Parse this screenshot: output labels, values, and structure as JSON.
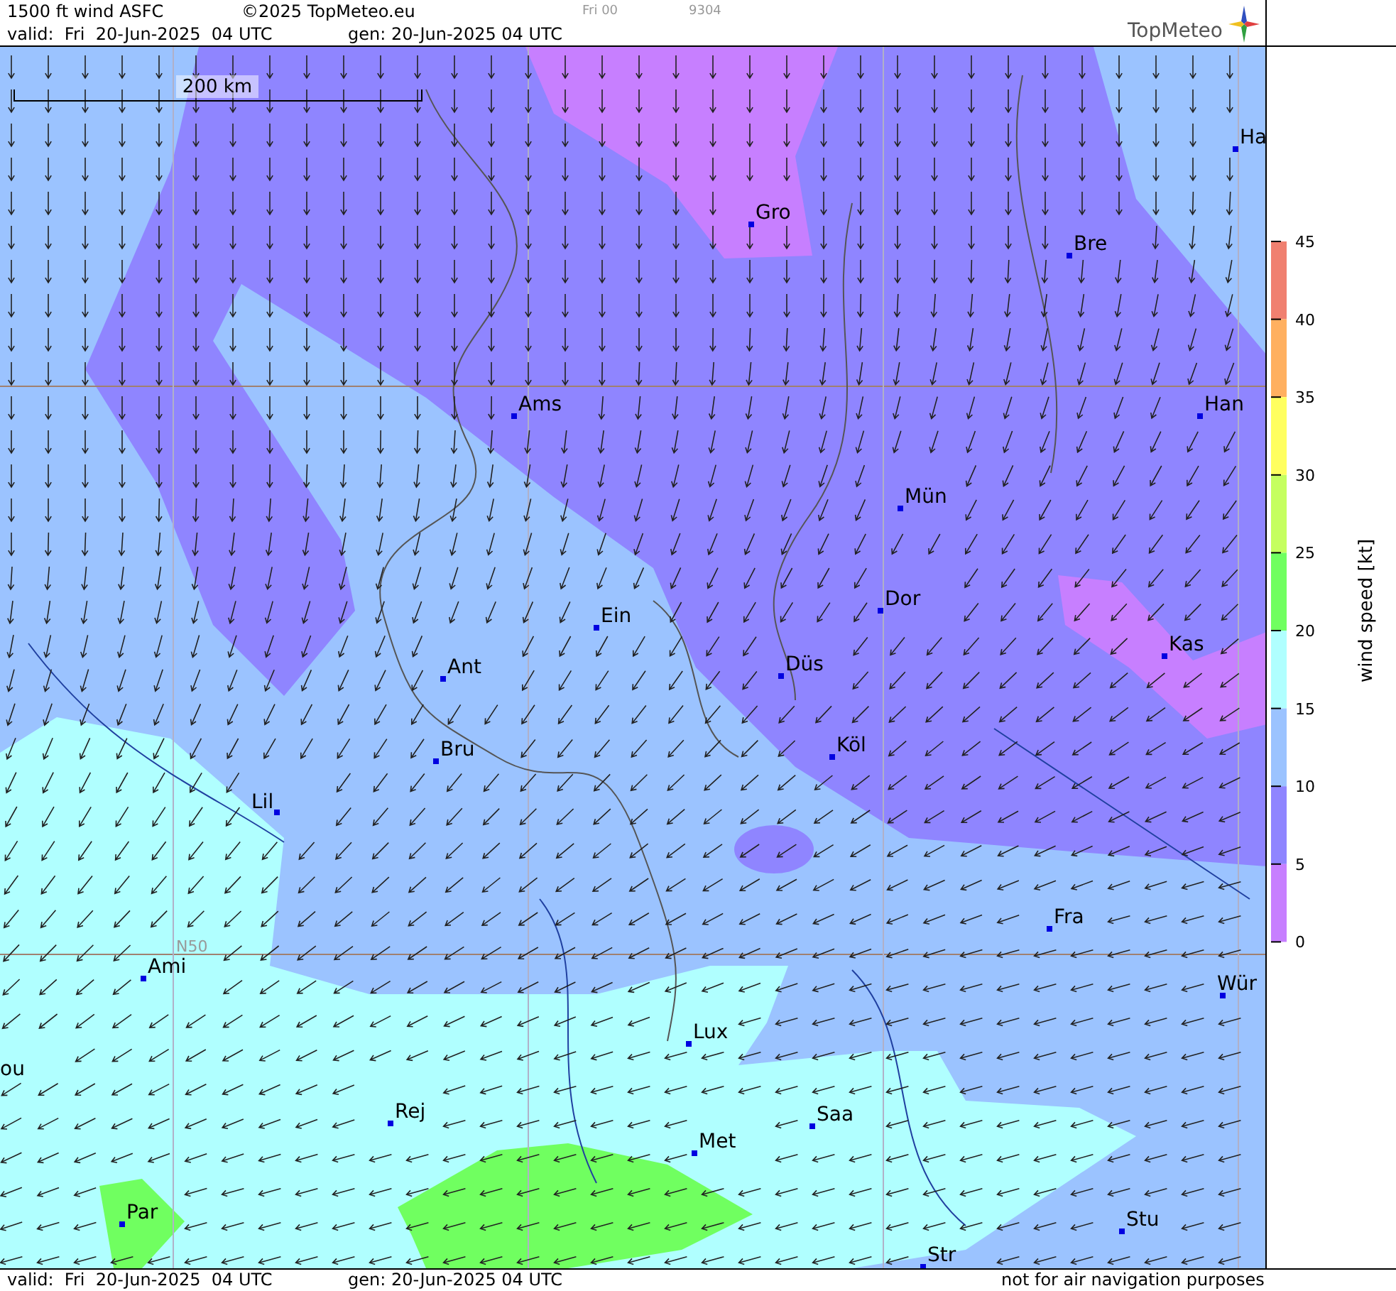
{
  "header": {
    "title": "1500 ft wind ASFC",
    "copyright": "©2025 TopMeteo.eu",
    "run": "Fri 00",
    "code": "9304",
    "valid": "valid:  Fri  20-Jun-2025  04 UTC",
    "generated": "gen: 20-Jun-2025 04 UTC",
    "logo": "TopMeteo"
  },
  "map": {
    "scale_label": "200 km",
    "grid_label": "N50",
    "cities": [
      {
        "label": "Ha"
      },
      {
        "label": "Gro"
      },
      {
        "label": "Bre"
      },
      {
        "label": "Ams"
      },
      {
        "label": "Han"
      },
      {
        "label": "Mün"
      },
      {
        "label": "Ein"
      },
      {
        "label": "Dor"
      },
      {
        "label": "Kas"
      },
      {
        "label": "Düs"
      },
      {
        "label": "Ant"
      },
      {
        "label": "Bru"
      },
      {
        "label": "Köl"
      },
      {
        "label": "Lil"
      },
      {
        "label": "Fra"
      },
      {
        "label": "Ami"
      },
      {
        "label": "Wür"
      },
      {
        "label": "Lux"
      },
      {
        "label": "ou"
      },
      {
        "label": "Rej"
      },
      {
        "label": "Saa"
      },
      {
        "label": "Met"
      },
      {
        "label": "Par"
      },
      {
        "label": "Stu"
      },
      {
        "label": "Str"
      }
    ]
  },
  "legend": {
    "title": "wind speed [kt]",
    "ticks": [
      "45",
      "40",
      "35",
      "30",
      "25",
      "20",
      "15",
      "10",
      "5",
      "0"
    ],
    "bands": [
      {
        "color": "#f08070"
      },
      {
        "color": "#ffb060"
      },
      {
        "color": "#ffff60"
      },
      {
        "color": "#c5ff60"
      },
      {
        "color": "#70ff60"
      },
      {
        "color": "#b0ffff"
      },
      {
        "color": "#9bc3ff"
      },
      {
        "color": "#8f85ff"
      },
      {
        "color": "#c77fff"
      }
    ]
  },
  "footer": {
    "valid": "valid:  Fri  20-Jun-2025  04 UTC",
    "generated": "gen: 20-Jun-2025 04 UTC",
    "disclaimer": "not for air navigation purposes"
  }
}
